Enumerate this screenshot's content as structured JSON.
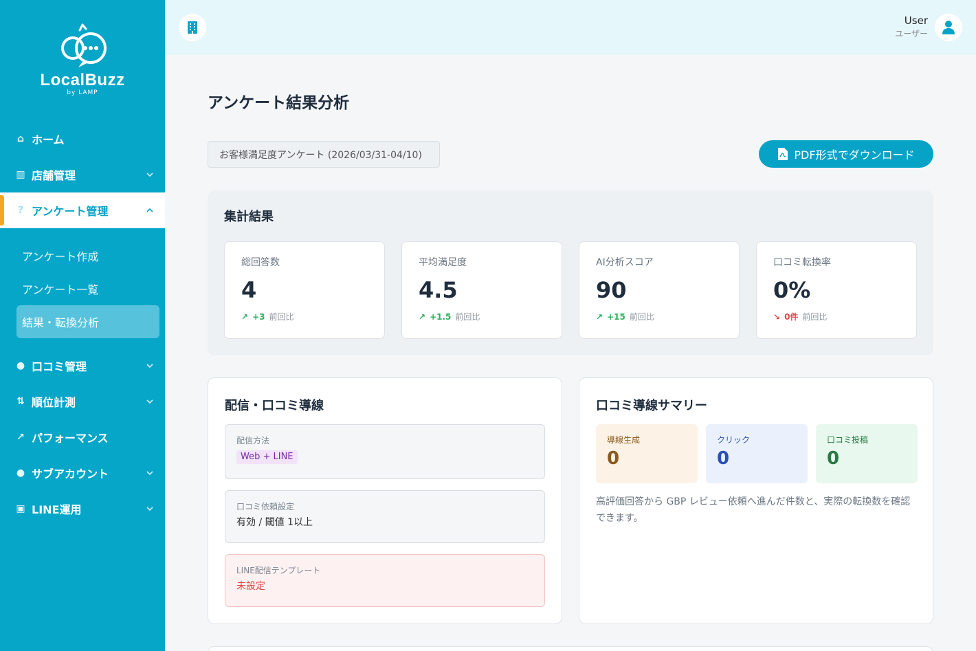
{
  "brand": {
    "name": "LocalBuzz",
    "sub": "by LAMP"
  },
  "sidebar": {
    "items": [
      {
        "label": "ホーム",
        "icon": "home-icon"
      },
      {
        "label": "店舗管理",
        "icon": "building-icon"
      },
      {
        "label": "アンケート管理",
        "icon": "question-icon"
      },
      {
        "label": "口コミ管理",
        "icon": "chat-icon"
      },
      {
        "label": "順位計測",
        "icon": "sort-icon"
      },
      {
        "label": "パフォーマンス",
        "icon": "chart-icon"
      },
      {
        "label": "サブアカウント",
        "icon": "user-icon"
      },
      {
        "label": "LINE運用",
        "icon": "robot-icon"
      }
    ],
    "sub_items": [
      {
        "label": "アンケート作成"
      },
      {
        "label": "アンケート一覧"
      },
      {
        "label": "結果・転換分析"
      }
    ]
  },
  "header": {
    "user_name": "User",
    "user_role": "ユーザー"
  },
  "main": {
    "title": "アンケート結果分析",
    "survey_select": "お客様満足度アンケート (2026/03/31-04/10)",
    "pdf_button": "PDF形式でダウンロード",
    "summary": {
      "title": "集計結果",
      "cards": [
        {
          "label": "総回答数",
          "value": "4",
          "delta": "+3",
          "suffix": "前回比",
          "trend": "up"
        },
        {
          "label": "平均満足度",
          "value": "4.5",
          "delta": "+1.5",
          "suffix": "前回比",
          "trend": "up"
        },
        {
          "label": "AI分析スコア",
          "value": "90",
          "delta": "+15",
          "suffix": "前回比",
          "trend": "up"
        },
        {
          "label": "口コミ転換率",
          "value": "0%",
          "delta": "0件",
          "suffix": "前回比",
          "trend": "down"
        }
      ]
    },
    "delivery": {
      "title": "配信・口コミ導線",
      "method_label": "配信方法",
      "method_value": "Web + LINE",
      "review_label": "口コミ依頼設定",
      "review_value": "有効 / 閾値 1以上",
      "template_label": "LINE配信テンプレート",
      "template_value": "未設定"
    },
    "review_summary": {
      "title": "口コミ導線サマリー",
      "items": [
        {
          "label": "導線生成",
          "value": "0"
        },
        {
          "label": "クリック",
          "value": "0"
        },
        {
          "label": "口コミ投稿",
          "value": "0"
        }
      ],
      "note": "高評価回答から GBP レビュー依頼へ進んだ件数と、実際の転換数を確認できます。"
    }
  },
  "colors": {
    "primary": "#06a6c9",
    "accent": "#f5a623",
    "up": "#2bb05a",
    "down": "#e04848"
  }
}
